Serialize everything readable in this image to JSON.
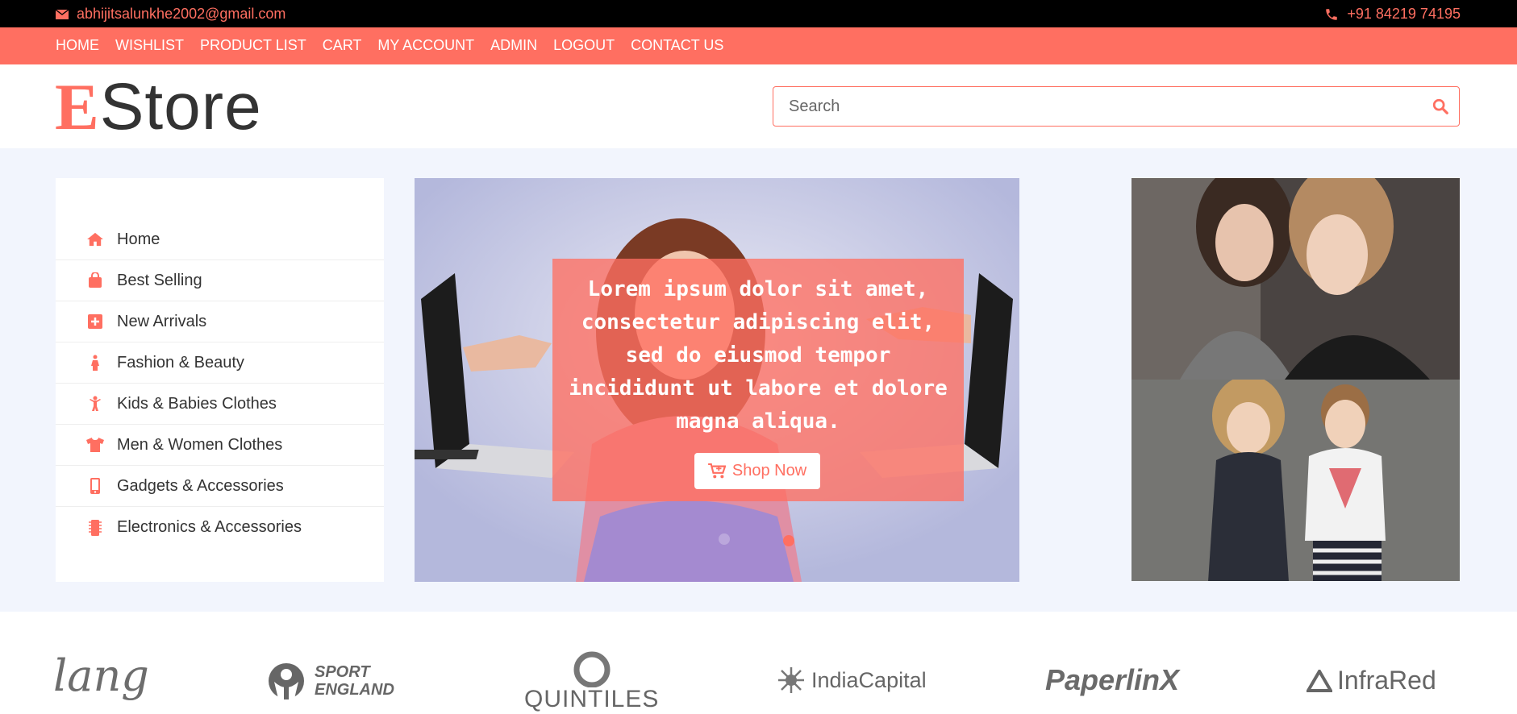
{
  "topbar": {
    "email": "abhijitsalunkhe2002@gmail.com",
    "email_icon": "envelope-icon",
    "phone": "+91 84219 74195",
    "phone_icon": "phone-icon"
  },
  "nav": {
    "items": [
      "HOME",
      "WISHLIST",
      "PRODUCT LIST",
      "CART",
      "MY ACCOUNT",
      "ADMIN",
      "LOGOUT",
      "CONTACT US"
    ]
  },
  "header": {
    "logo_first": "E",
    "logo_rest": "Store",
    "search_placeholder": "Search",
    "search_icon": "search-icon"
  },
  "sidebar": {
    "items": [
      {
        "label": "Home",
        "icon": "home-icon"
      },
      {
        "label": "Best Selling",
        "icon": "shopping-bag-icon"
      },
      {
        "label": "New Arrivals",
        "icon": "plus-square-icon"
      },
      {
        "label": "Fashion & Beauty",
        "icon": "female-icon"
      },
      {
        "label": "Kids & Babies Clothes",
        "icon": "child-icon"
      },
      {
        "label": "Men & Women Clothes",
        "icon": "tshirt-icon"
      },
      {
        "label": "Gadgets & Accessories",
        "icon": "mobile-icon"
      },
      {
        "label": "Electronics & Accessories",
        "icon": "microchip-icon"
      }
    ]
  },
  "carousel": {
    "caption": "Lorem ipsum dolor sit amet, consectetur adipiscing elit, sed do eiusmod tempor incididunt ut labore et dolore magna aliqua.",
    "button_label": "Shop Now",
    "button_icon": "cart-icon"
  },
  "brands": [
    "lang",
    "SPORT ENGLAND",
    "QUINTILES",
    "IndiaCapital",
    "PaperlinX",
    "InfraRed"
  ],
  "colors": {
    "accent": "#ff6f61",
    "topbar_bg": "#000000",
    "hero_bg": "#f2f5fd"
  }
}
